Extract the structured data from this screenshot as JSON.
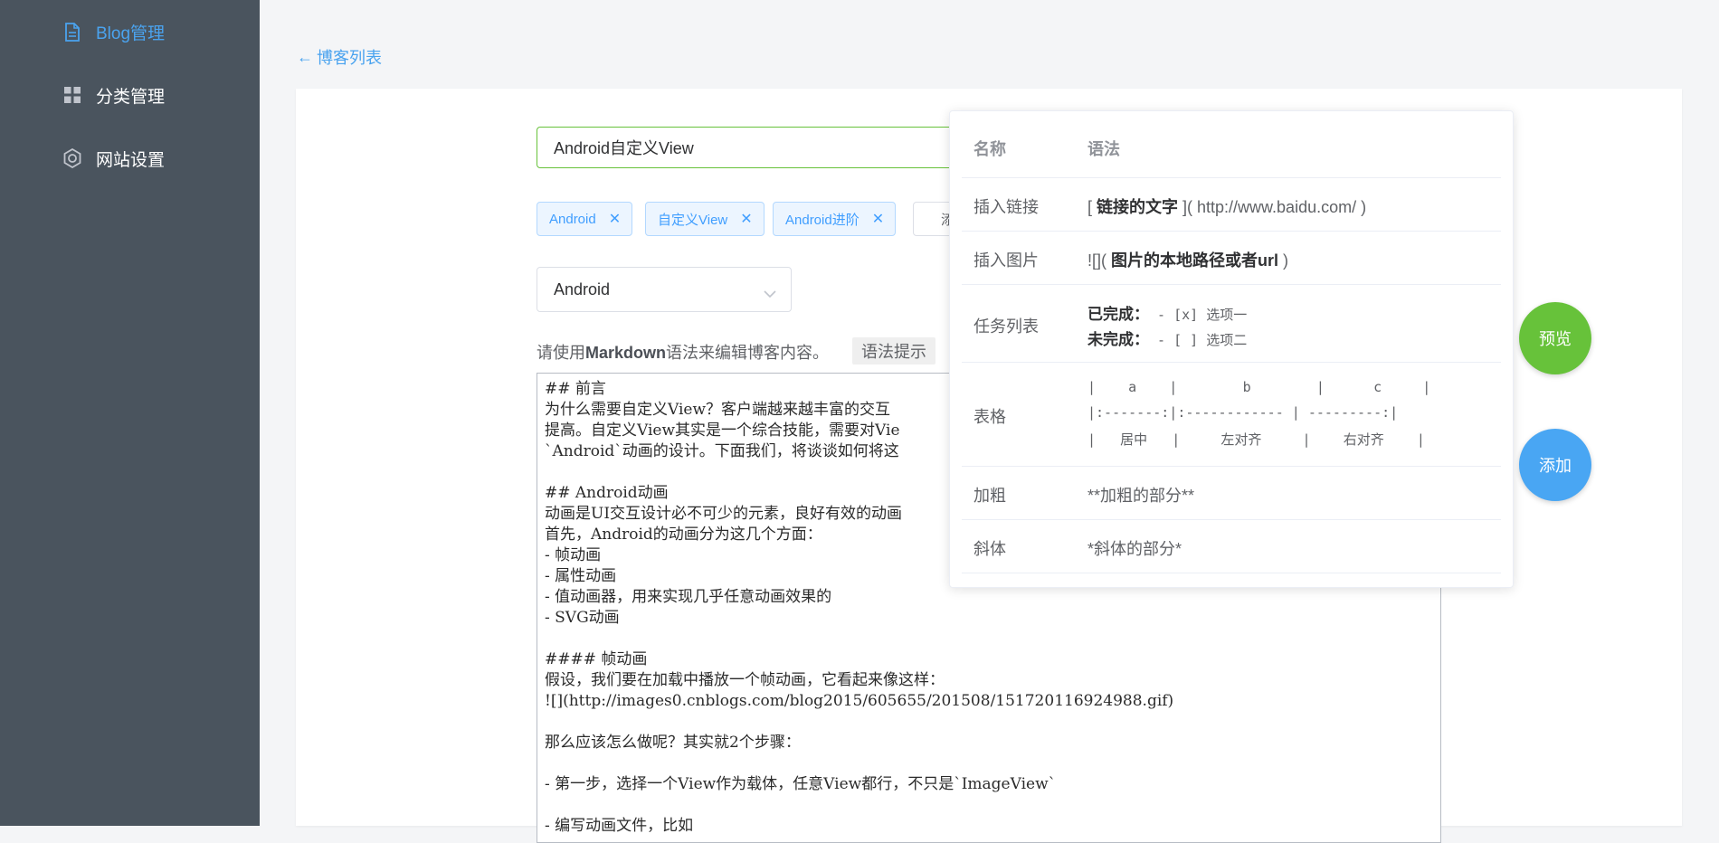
{
  "sidebar": {
    "items": [
      {
        "label": "Blog管理",
        "icon": "document-icon",
        "active": true
      },
      {
        "label": "分类管理",
        "icon": "grid-icon",
        "active": false
      },
      {
        "label": "网站设置",
        "icon": "gear-icon",
        "active": false
      }
    ]
  },
  "header": {
    "back_label": "博客列表"
  },
  "form": {
    "title_value": "Android自定义View",
    "tags": [
      "Android",
      "自定义View",
      "Android进阶"
    ],
    "tag_add_label": "添",
    "category_value": "Android",
    "hint_prefix": "请使用",
    "hint_bold": "Markdown",
    "hint_suffix": "语法来编辑博客内容。",
    "syntax_button": "语法提示",
    "editor_lines": [
      "## 前言",
      "为什么需要自定义View？客户端越来越丰富的交互",
      "提高。自定义View其实是一个综合技能，需要对Vie",
      "`Android`动画的设计。下面我们，将谈谈如何将这",
      "",
      "## Android动画",
      "动画是UI交互设计必不可少的元素，良好有效的动画",
      "首先，Android的动画分为这几个方面：",
      "- 帧动画",
      "- 属性动画",
      "- 值动画器，用来实现几乎任意动画效果的",
      "- SVG动画",
      "",
      "#### 帧动画",
      "假设，我们要在加载中播放一个帧动画，它看起来像这样：",
      "![](http://images0.cnblogs.com/blog2015/605655/201508/151720116924988.gif)",
      "",
      "那么应该怎么做呢？其实就2个步骤：",
      "",
      "- 第一步，选择一个View作为载体，任意View都行，不只是`ImageView`",
      "",
      "- 编写动画文件，比如"
    ]
  },
  "syntax_popover": {
    "header": {
      "name": "名称",
      "syntax": "语法"
    },
    "rows": {
      "link": {
        "name": "插入链接",
        "open": "[ ",
        "bold": "链接的文字",
        "rest": " ]( http://www.baidu.com/ )"
      },
      "image": {
        "name": "插入图片",
        "open": "![]( ",
        "bold": "图片的本地路径或者url",
        "rest": " )"
      },
      "task": {
        "name": "任务列表",
        "done_label": "已完成：",
        "done_value": " - [x] 选项一",
        "todo_label": "未完成：",
        "todo_value": " - [ ] 选项二"
      },
      "table": {
        "name": "表格",
        "line1": "|    a    |        b        |      c     |",
        "line2": "|:-------:|:------------ | ---------:|",
        "line3": "|   居中   |     左对齐     |    右对齐    |"
      },
      "bold": {
        "name": "加粗",
        "syntax": "**加粗的部分**"
      },
      "italic": {
        "name": "斜体",
        "syntax": "*斜体的部分*"
      }
    }
  },
  "actions": {
    "preview": "预览",
    "add": "添加"
  },
  "colors": {
    "sidebar_bg": "#4a545e",
    "accent_blue": "#4aa3ef",
    "success_green": "#67c23a"
  }
}
